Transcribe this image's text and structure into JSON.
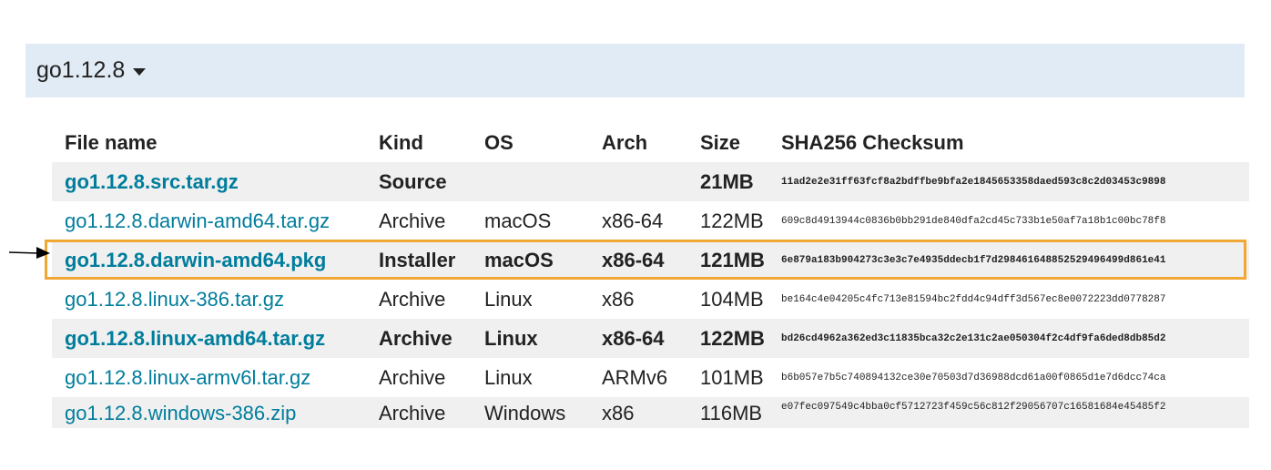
{
  "version_header": {
    "title": "go1.12.8",
    "icon": "caret-down-icon"
  },
  "table": {
    "headers": {
      "file_name": "File name",
      "kind": "Kind",
      "os": "OS",
      "arch": "Arch",
      "size": "Size",
      "sha256": "SHA256 Checksum"
    },
    "rows": [
      {
        "file": "go1.12.8.src.tar.gz",
        "kind": "Source",
        "os": "",
        "arch": "",
        "size": "21MB",
        "sha256": "11ad2e2e31ff63fcf8a2bdffbe9bfa2e1845653358daed593c8c2d03453c9898",
        "highlighted": true
      },
      {
        "file": "go1.12.8.darwin-amd64.tar.gz",
        "kind": "Archive",
        "os": "macOS",
        "arch": "x86-64",
        "size": "122MB",
        "sha256": "609c8d4913944c0836b0bb291de840dfa2cd45c733b1e50af7a18b1c00bc78f8",
        "highlighted": false
      },
      {
        "file": "go1.12.8.darwin-amd64.pkg",
        "kind": "Installer",
        "os": "macOS",
        "arch": "x86-64",
        "size": "121MB",
        "sha256": "6e879a183b904273c3e3c7e4935ddecb1f7d298461648852529496499d861e41",
        "highlighted": true
      },
      {
        "file": "go1.12.8.linux-386.tar.gz",
        "kind": "Archive",
        "os": "Linux",
        "arch": "x86",
        "size": "104MB",
        "sha256": "be164c4e04205c4fc713e81594bc2fdd4c94dff3d567ec8e0072223dd0778287",
        "highlighted": false
      },
      {
        "file": "go1.12.8.linux-amd64.tar.gz",
        "kind": "Archive",
        "os": "Linux",
        "arch": "x86-64",
        "size": "122MB",
        "sha256": "bd26cd4962a362ed3c11835bca32c2e131c2ae050304f2c4df9fa6ded8db85d2",
        "highlighted": true
      },
      {
        "file": "go1.12.8.linux-armv6l.tar.gz",
        "kind": "Archive",
        "os": "Linux",
        "arch": "ARMv6",
        "size": "101MB",
        "sha256": "b6b057e7b5c740894132ce30e70503d7d36988dcd61a00f0865d1e7d6dcc74ca",
        "highlighted": false
      },
      {
        "file": "go1.12.8.windows-386.zip",
        "kind": "Archive",
        "os": "Windows",
        "arch": "x86",
        "size": "116MB",
        "sha256": "e07fec097549c4bba0cf5712723f459c56c812f29056707c16581684e45485f2",
        "highlighted": false
      }
    ]
  },
  "annotation": {
    "highlight_color": "#f0a733",
    "icon": "arrow-right-icon"
  },
  "colors": {
    "link": "#007d9c",
    "header_band": "#e0ebf5",
    "row_shade": "#f0f0f0"
  }
}
